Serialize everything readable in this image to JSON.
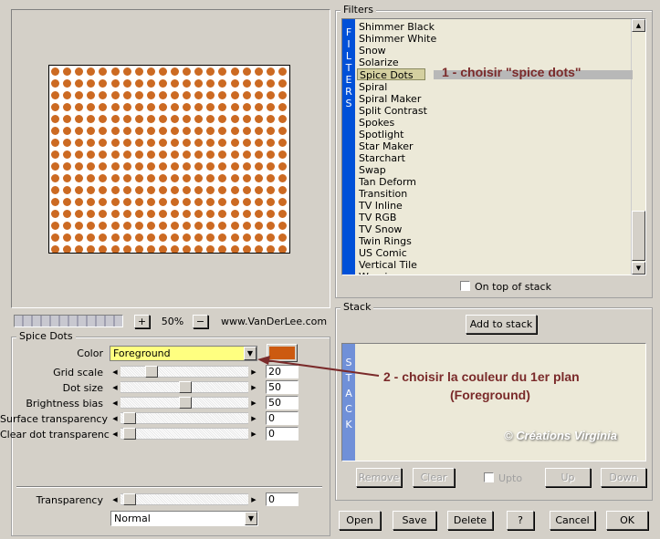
{
  "preview": {
    "zoom": "50%",
    "plus": "+",
    "minus": "−",
    "website": "www.VanDerLee.com",
    "dot_color": "#cc6a22"
  },
  "spice_dots": {
    "title": "Spice Dots",
    "color_label": "Color",
    "color_value": "Foreground",
    "swatch": "#cc5a10",
    "params": [
      {
        "label": "Grid scale",
        "value": "20",
        "level": 0.2
      },
      {
        "label": "Dot size",
        "value": "50",
        "level": 0.5
      },
      {
        "label": "Brightness bias",
        "value": "50",
        "level": 0.5
      },
      {
        "label": "Surface transparency",
        "value": "0",
        "level": 0
      },
      {
        "label": "Clear dot transparency",
        "value": "0",
        "level": 0
      }
    ],
    "transparency_label": "Transparency",
    "transparency_value": "0",
    "blend_mode": "Normal"
  },
  "filters": {
    "title": "Filters",
    "side_label": [
      "F",
      "I",
      "L",
      "T",
      "E",
      "R",
      "S"
    ],
    "items": [
      "Shimmer Black",
      "Shimmer White",
      "Snow",
      "Solarize",
      "Spice Dots",
      "Spiral",
      "Spiral Maker",
      "Split Contrast",
      "Spokes",
      "Spotlight",
      "Star Maker",
      "Starchart",
      "Swap",
      "Tan Deform",
      "Transition",
      "TV Inline",
      "TV RGB",
      "TV Snow",
      "Twin Rings",
      "US Comic",
      "Vertical Tile",
      "Warping"
    ],
    "selected": "Spice Dots",
    "on_top_label": "On top of stack"
  },
  "stack": {
    "title": "Stack",
    "add_label": "Add to stack",
    "side_label": [
      "S",
      "T",
      "A",
      "C",
      "K"
    ],
    "remove": "Remove",
    "clear": "Clear",
    "upto": "Upto",
    "up": "Up",
    "down": "Down"
  },
  "bottom": {
    "open": "Open",
    "save": "Save",
    "delete": "Delete",
    "help": "?",
    "cancel": "Cancel",
    "ok": "OK"
  },
  "annotations": {
    "a1": "1 - choisir \"spice dots\"",
    "a2_line1": "2 - choisir la couleur du 1er plan",
    "a2_line2": "(Foreground)",
    "watermark": "© Créations Virginia"
  }
}
